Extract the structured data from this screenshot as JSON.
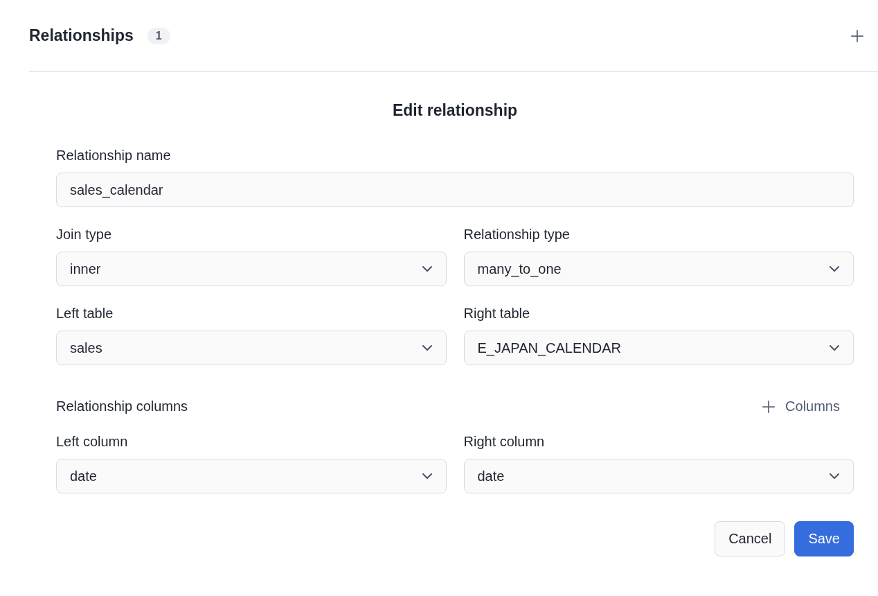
{
  "header": {
    "title": "Relationships",
    "count": "1"
  },
  "form": {
    "title": "Edit relationship",
    "name_field": {
      "label": "Relationship name",
      "value": "sales_calendar"
    },
    "row_1": [
      {
        "label": "Join type",
        "value": "inner"
      },
      {
        "label": "Relationship type",
        "value": "many_to_one"
      }
    ],
    "row_2": [
      {
        "label": "Left table",
        "value": "sales"
      },
      {
        "label": "Right table",
        "value": "E_JAPAN_CALENDAR"
      }
    ],
    "columns_section": {
      "title": "Relationship columns",
      "add_label": "Columns"
    },
    "row_3": [
      {
        "label": "Left column",
        "value": "date"
      },
      {
        "label": "Right column",
        "value": "date"
      }
    ],
    "buttons": [
      {
        "label": "Cancel",
        "kind": "secondary"
      },
      {
        "label": "Save",
        "kind": "primary"
      }
    ]
  }
}
